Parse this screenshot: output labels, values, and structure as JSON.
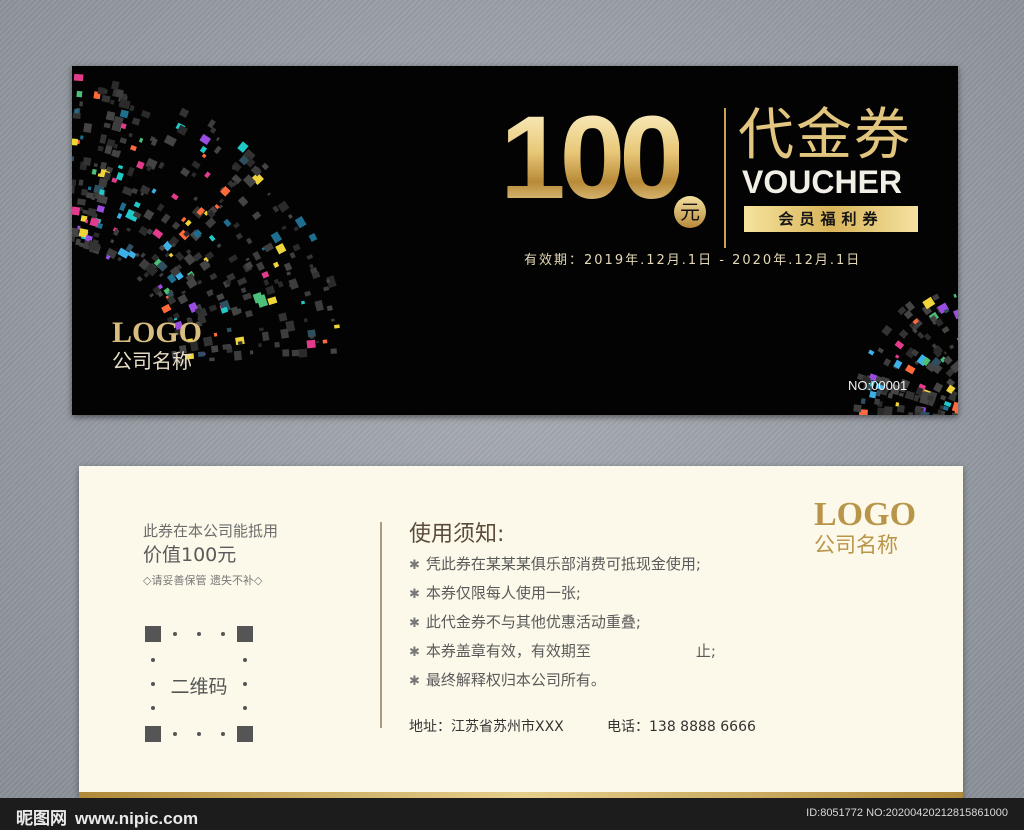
{
  "front": {
    "amount": "100",
    "currency": "元",
    "title_cn": "代金券",
    "title_en": "VOUCHER",
    "member_label": "会员福利券",
    "validity": "有效期：2019年.12月.1日 - 2020年.12月.1日",
    "logo": "LOGO",
    "company": "公司名称",
    "serial": "NO:00001"
  },
  "back": {
    "use_note": "此券在本公司能抵用",
    "value_note": "价值100元",
    "keep_note": "◇请妥善保管 遗失不补◇",
    "qr_label": "二维码",
    "rules_title": "使用须知:",
    "rules": [
      "凭此券在某某某俱乐部消费可抵现金使用;",
      "本券仅限每人使用一张;",
      "此代金券不与其他优惠活动重叠;",
      "本券盖章有效，有效期至　　　　　　　止;",
      "最终解释权归本公司所有。"
    ],
    "address": "地址：江苏省苏州市XXX",
    "phone": "电话：138 8888 6666",
    "logo": "LOGO",
    "company": "公司名称"
  },
  "footer": {
    "watermark_cn": "昵图网",
    "watermark_url": "www.nipic.com",
    "id_text": "ID:8051772 NO:20200420212815861000"
  },
  "colors": {
    "gold": "#d9b45a",
    "card_dark": "#030303",
    "card_light": "#fcf9ea"
  }
}
